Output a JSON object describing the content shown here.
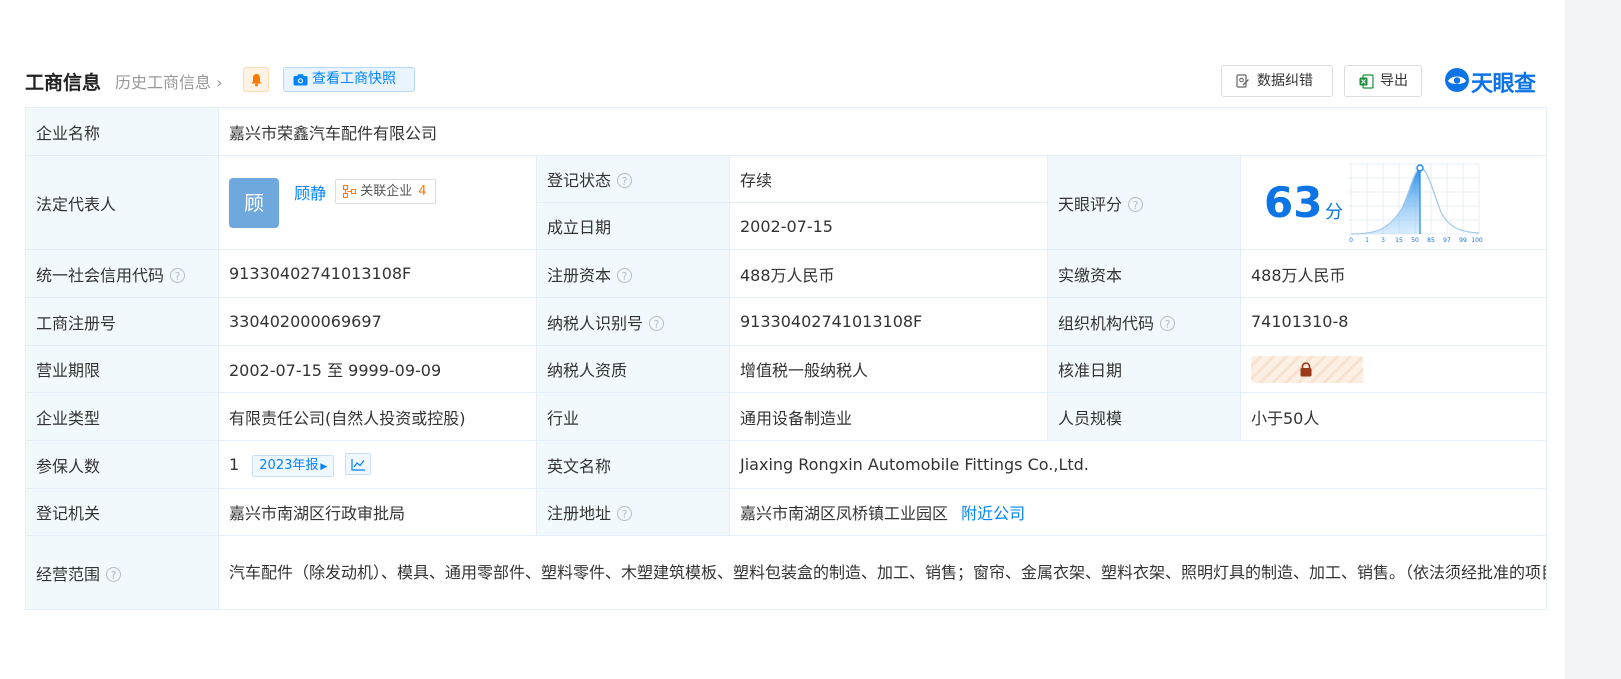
{
  "header": {
    "title": "工商信息",
    "history_link": "历史工商信息",
    "snapshot_button": "查看工商快照",
    "correct_button": "数据纠错",
    "export_button": "导出",
    "logo_text": "天眼查"
  },
  "rows": {
    "company_name": {
      "label": "企业名称",
      "value": "嘉兴市荣鑫汽车配件有限公司"
    },
    "legal_rep": {
      "label": "法定代表人",
      "avatar_char": "顾",
      "name": "顾静",
      "related_label": "关联企业",
      "related_count": "4"
    },
    "reg_status": {
      "label": "登记状态",
      "value": "存续"
    },
    "established": {
      "label": "成立日期",
      "value": "2002-07-15"
    },
    "score": {
      "label": "天眼评分",
      "value": "63",
      "unit": "分",
      "ticks": [
        "0",
        "1",
        "3",
        "15",
        "50",
        "85",
        "97",
        "99",
        "100"
      ]
    },
    "credit_code": {
      "label": "统一社会信用代码",
      "value": "91330402741013108F"
    },
    "reg_capital": {
      "label": "注册资本",
      "value": "488万人民币"
    },
    "paid_capital": {
      "label": "实缴资本",
      "value": "488万人民币"
    },
    "reg_number": {
      "label": "工商注册号",
      "value": "330402000069697"
    },
    "taxpayer_id": {
      "label": "纳税人识别号",
      "value": "91330402741013108F"
    },
    "org_code": {
      "label": "组织机构代码",
      "value": "74101310-8"
    },
    "term": {
      "label": "营业期限",
      "value": "2002-07-15 至 9999-09-09"
    },
    "taxpayer_qual": {
      "label": "纳税人资质",
      "value": "增值税一般纳税人"
    },
    "approval_date": {
      "label": "核准日期"
    },
    "company_type": {
      "label": "企业类型",
      "value": "有限责任公司(自然人投资或控股)"
    },
    "industry": {
      "label": "行业",
      "value": "通用设备制造业"
    },
    "staff_size": {
      "label": "人员规模",
      "value": "小于50人"
    },
    "insured": {
      "label": "参保人数",
      "value": "1",
      "report_badge": "2023年报"
    },
    "english_name": {
      "label": "英文名称",
      "value": "Jiaxing Rongxin Automobile Fittings Co.,Ltd."
    },
    "authority": {
      "label": "登记机关",
      "value": "嘉兴市南湖区行政审批局"
    },
    "address": {
      "label": "注册地址",
      "value": "嘉兴市南湖区凤桥镇工业园区",
      "nearby_link": "附近公司"
    },
    "scope": {
      "label": "经营范围",
      "value": "汽车配件（除发动机）、模具、通用零部件、塑料零件、木塑建筑模板、塑料包装盒的制造、加工、销售；窗帘、金属衣架、塑料衣架、照明灯具的制造、加工、销售。（依法须经批准的项目，经相关部门批准后方可开展经营活动）"
    }
  }
}
